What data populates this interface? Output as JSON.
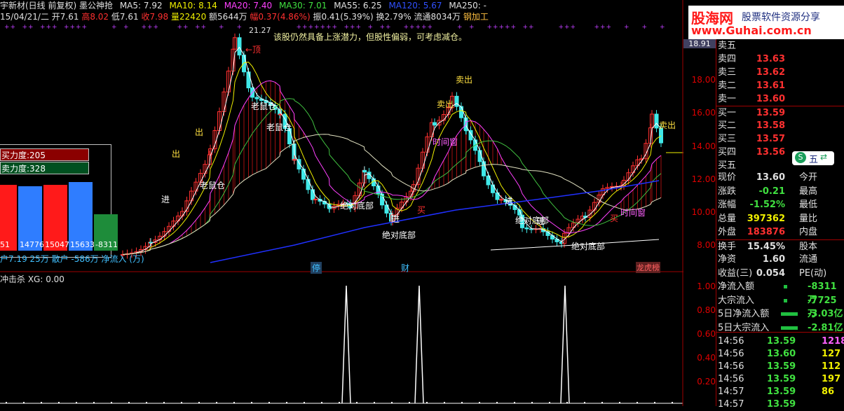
{
  "topbar": {
    "title": "宇新材(日线 前复权) 墨公神抢",
    "ma5": "MA5: 7.92",
    "ma10": "MA10: 8.14",
    "ma20": "MA20: 7.40",
    "ma30": "MA30: 7.01",
    "ma55": "MA55: 6.25",
    "ma120": "MA120: 5.67",
    "ma250": "MA250: -"
  },
  "quote_line": {
    "date": "15/04/21/二",
    "open": "开7.61",
    "high": "高8.02",
    "low": "低7.61",
    "close": "收7.98",
    "vol": "量22420",
    "amount": "额5644万",
    "chg": "幅0.37(4.86%)",
    "amp": "振0.41(5.39%)",
    "turnover": "换2.79%",
    "float": "流通8034万",
    "sector": "钢加工"
  },
  "main_chart": {
    "comment": "该股仍然具备上涨潜力，但股性偏弱，可考虑减仓。",
    "peak_label": "21.27",
    "top_label": "←顶",
    "labels": [
      "老鼠仓",
      "老鼠仓",
      "老鼠仓",
      "绝对底部",
      "绝对底部",
      "绝对底部",
      "绝对底部",
      "时间窗",
      "时间窗",
      "卖出",
      "卖出",
      "卖出",
      "进",
      "进",
      "进",
      "进",
      "买",
      "买",
      "出",
      "出"
    ],
    "markers": [
      "停",
      "财",
      "龙虎榜"
    ],
    "y_ticks": [
      "18.00",
      "16.00",
      "14.00",
      "12.00",
      "10.00",
      "8.00"
    ]
  },
  "left_panel": {
    "buy_strength": "买力度:205",
    "sell_strength": "卖力度:328",
    "bars": [
      {
        "label": "51",
        "color": "#ff1a1a",
        "value": 15100
      },
      {
        "label": "14776",
        "color": "#2f7dff",
        "value": 14776
      },
      {
        "label": "15047",
        "color": "#ff1a1a",
        "value": 15047
      },
      {
        "label": "15633",
        "color": "#2f7dff",
        "value": 15633
      },
      {
        "label": "-8311",
        "color": "#1e8c3a",
        "value": 8311
      }
    ],
    "bottom_text": "户7.19 25万  散户 -586万  净流入 (万)"
  },
  "sub_chart": {
    "title": "冲击杀 XG: 0.00",
    "y_ticks": [
      "1.00",
      "0.80",
      "0.60",
      "0.40",
      "0.20"
    ]
  },
  "right_panel": {
    "logo_title": "股海网",
    "logo_sub": "股票软件资源分享",
    "logo_url": "www.Guhai.com.cn",
    "top_price": "18.91",
    "order_book": [
      {
        "label": "卖五",
        "price": ""
      },
      {
        "label": "卖四",
        "price": "13.63"
      },
      {
        "label": "卖三",
        "price": "13.62"
      },
      {
        "label": "卖二",
        "price": "13.61"
      },
      {
        "label": "卖一",
        "price": "13.60"
      },
      {
        "label": "买一",
        "price": "13.59"
      },
      {
        "label": "买二",
        "price": "13.58"
      },
      {
        "label": "买三",
        "price": "13.57"
      },
      {
        "label": "买四",
        "price": "13.56"
      },
      {
        "label": "买五",
        "price": ""
      }
    ],
    "float_badge": "五",
    "stats": [
      {
        "l1": "现价",
        "v1": "13.60",
        "l2": "今开",
        "v2": ""
      },
      {
        "l1": "涨跌",
        "v1": "-0.21",
        "l2": "最高",
        "v2": ""
      },
      {
        "l1": "涨幅",
        "v1": "-1.52%",
        "l2": "最低",
        "v2": ""
      },
      {
        "l1": "总量",
        "v1": "397362",
        "l2": "量比",
        "v2": ""
      },
      {
        "l1": "外盘",
        "v1": "183876",
        "l2": "内盘",
        "v2": ""
      },
      {
        "l1": "换手",
        "v1": "15.45%",
        "l2": "股本",
        "v2": ""
      },
      {
        "l1": "净资",
        "v1": "1.60",
        "l2": "流通",
        "v2": ""
      },
      {
        "l1": "收益(三)",
        "v1": "0.054",
        "l2": "PE(动)",
        "v2": ""
      }
    ],
    "flows": [
      {
        "label": "净流入额",
        "value": "-8311万"
      },
      {
        "label": "大宗流入",
        "value": "-7725万"
      },
      {
        "label": "5日净流入额",
        "value": "-3.03亿"
      },
      {
        "label": "5日大宗流入",
        "value": "-2.81亿"
      }
    ],
    "ticks": [
      {
        "time": "14:56",
        "price": "13.59",
        "vol": "1218"
      },
      {
        "time": "14:56",
        "price": "13.60",
        "vol": "127"
      },
      {
        "time": "14:56",
        "price": "13.59",
        "vol": "112"
      },
      {
        "time": "14:56",
        "price": "13.59",
        "vol": "197"
      },
      {
        "time": "14:57",
        "price": "13.59",
        "vol": "86"
      },
      {
        "time": "14:57",
        "price": "13.59",
        "vol": ""
      }
    ]
  }
}
